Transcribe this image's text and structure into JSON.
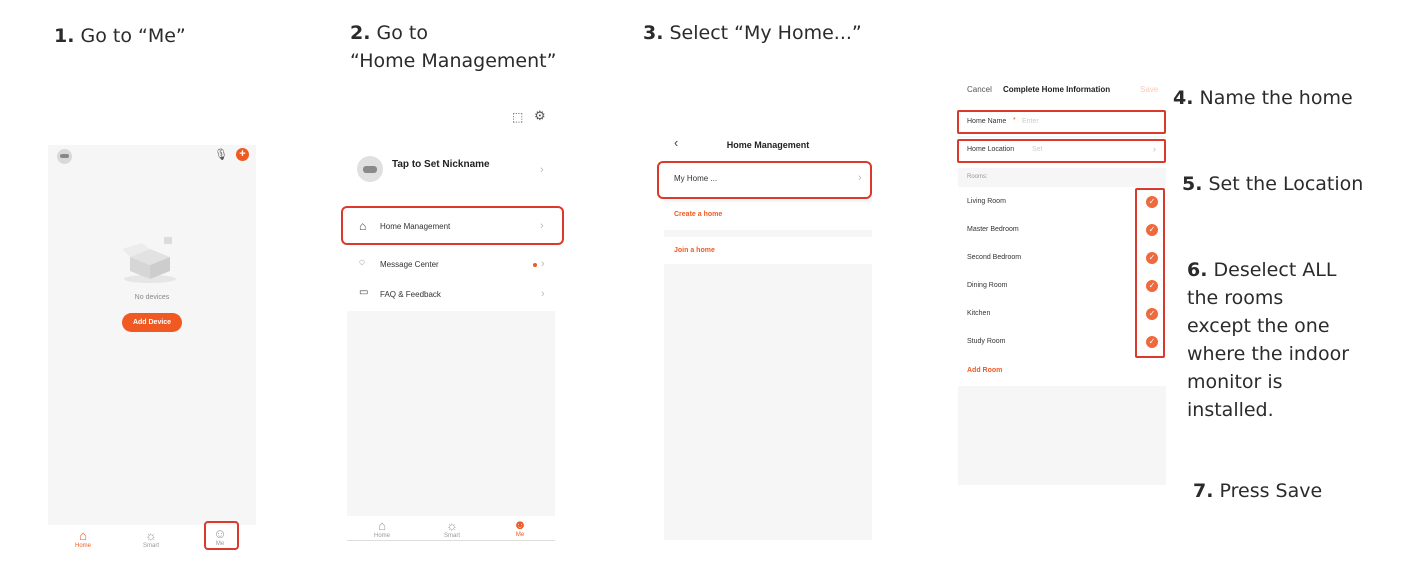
{
  "steps": {
    "s1": {
      "num": "1.",
      "text": " Go to “Me”"
    },
    "s2": {
      "num": "2.",
      "line1": " Go to",
      "line2": "“Home Management”"
    },
    "s3": {
      "num": "3.",
      "text": " Select “My Home...”"
    },
    "s4": {
      "num": "4.",
      "text": " Name the home"
    },
    "s5": {
      "num": "5.",
      "text": " Set the Location"
    },
    "s6": {
      "num": "6.",
      "line1": " Deselect ALL",
      "line2": "the rooms",
      "line3": "except the one",
      "line4": "where the indoor",
      "line5": "monitor is",
      "line6": "installed."
    },
    "s7": {
      "num": "7.",
      "text": " Press Save"
    }
  },
  "screen1": {
    "no_devices": "No devices",
    "add_device": "Add Device",
    "tabs": [
      "Home",
      "Smart",
      "Me"
    ]
  },
  "screen2": {
    "nickname": "Tap to Set Nickname",
    "items": [
      "Home Management",
      "Message Center",
      "FAQ & Feedback"
    ],
    "tabs": [
      "Home",
      "Smart",
      "Me"
    ]
  },
  "screen3": {
    "title": "Home Management",
    "my_home": "My Home ...",
    "create": "Create a home",
    "join": "Join a home"
  },
  "screen4": {
    "cancel": "Cancel",
    "title": "Complete Home Information",
    "save": "Save",
    "home_name_label": "Home Name",
    "required": "*",
    "home_name_placeholder": "Enter",
    "home_location_label": "Home Location",
    "home_location_value": "Set",
    "rooms_label": "Rooms:",
    "rooms": [
      "Living Room",
      "Master Bedroom",
      "Second Bedroom",
      "Dining Room",
      "Kitchen",
      "Study Room"
    ],
    "add_room": "Add Room"
  },
  "icons": {
    "check": "check-circle-icon",
    "chevron": "chevron-right-icon",
    "back": "chevron-left-icon"
  },
  "colors": {
    "accent": "#f05a22",
    "highlight": "#d93a2b"
  }
}
